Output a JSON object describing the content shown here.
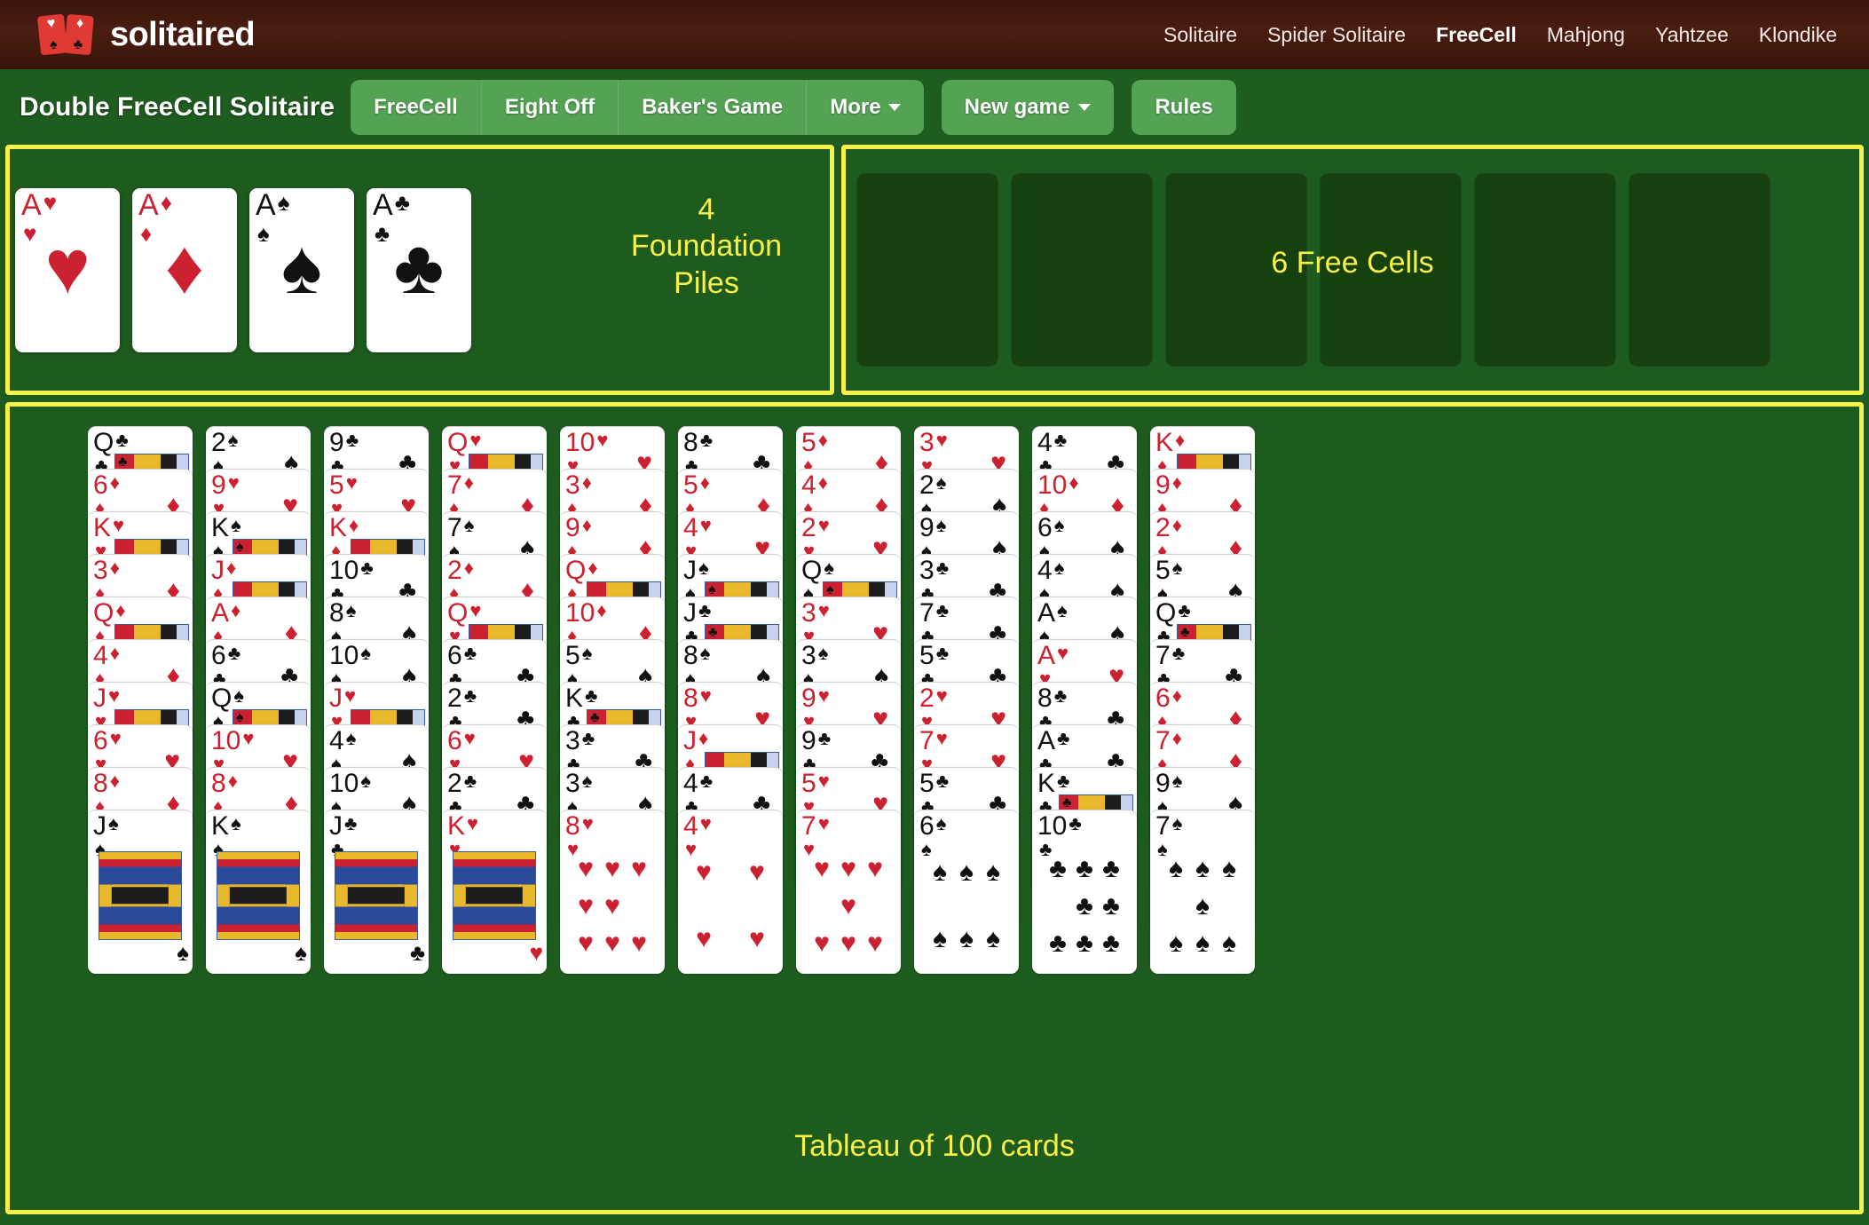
{
  "header": {
    "brand": "solitaired",
    "brand_icon": "two-playing-cards-logo",
    "nav": [
      {
        "label": "Solitaire",
        "active": false
      },
      {
        "label": "Spider Solitaire",
        "active": false
      },
      {
        "label": "FreeCell",
        "active": true
      },
      {
        "label": "Mahjong",
        "active": false
      },
      {
        "label": "Yahtzee",
        "active": false
      },
      {
        "label": "Klondike",
        "active": false
      }
    ]
  },
  "toolbar": {
    "game_title": "Double FreeCell Solitaire",
    "variants": [
      {
        "label": "FreeCell",
        "dropdown": false
      },
      {
        "label": "Eight Off",
        "dropdown": false
      },
      {
        "label": "Baker's Game",
        "dropdown": false
      },
      {
        "label": "More",
        "dropdown": true
      }
    ],
    "new_game_label": "New game",
    "rules_label": "Rules"
  },
  "board": {
    "foundation_label": "4\nFoundation\nPiles",
    "foundation_label_lines": [
      "4",
      "Foundation",
      "Piles"
    ],
    "freecell_label": "6 Free Cells",
    "tableau_label": "Tableau of 100 cards",
    "foundations": [
      {
        "rank": "A",
        "suit": "♥",
        "color": "red"
      },
      {
        "rank": "A",
        "suit": "♦",
        "color": "red"
      },
      {
        "rank": "A",
        "suit": "♠",
        "color": "black"
      },
      {
        "rank": "A",
        "suit": "♣",
        "color": "black"
      }
    ],
    "free_cells": [
      {
        "empty": true
      },
      {
        "empty": true
      },
      {
        "empty": true
      },
      {
        "empty": true
      },
      {
        "empty": true
      },
      {
        "empty": true
      }
    ],
    "colors": {
      "accent_yellow": "#f7f14a",
      "felt_green": "#1e5b1e",
      "button_green": "#54a354",
      "nav_brown": "#3b150c",
      "card_red": "#cc2131",
      "card_black": "#111111"
    },
    "tableau": [
      {
        "cards": [
          {
            "rank": "Q",
            "suit": "♣",
            "color": "black",
            "face": true
          },
          {
            "rank": "6",
            "suit": "♦",
            "color": "red",
            "face": false
          },
          {
            "rank": "K",
            "suit": "♥",
            "color": "red",
            "face": true
          },
          {
            "rank": "3",
            "suit": "♦",
            "color": "red",
            "face": false
          },
          {
            "rank": "Q",
            "suit": "♦",
            "color": "red",
            "face": true
          },
          {
            "rank": "4",
            "suit": "♦",
            "color": "red",
            "face": false
          },
          {
            "rank": "J",
            "suit": "♥",
            "color": "red",
            "face": true
          },
          {
            "rank": "6",
            "suit": "♥",
            "color": "red",
            "face": false
          },
          {
            "rank": "8",
            "suit": "♦",
            "color": "red",
            "face": false
          },
          {
            "rank": "J",
            "suit": "♠",
            "color": "black",
            "face": true,
            "bottom": true
          }
        ]
      },
      {
        "cards": [
          {
            "rank": "2",
            "suit": "♠",
            "color": "black",
            "face": false
          },
          {
            "rank": "9",
            "suit": "♥",
            "color": "red",
            "face": false
          },
          {
            "rank": "K",
            "suit": "♠",
            "color": "black",
            "face": true
          },
          {
            "rank": "J",
            "suit": "♦",
            "color": "red",
            "face": true
          },
          {
            "rank": "A",
            "suit": "♦",
            "color": "red",
            "face": false
          },
          {
            "rank": "6",
            "suit": "♣",
            "color": "black",
            "face": false
          },
          {
            "rank": "Q",
            "suit": "♠",
            "color": "black",
            "face": true
          },
          {
            "rank": "10",
            "suit": "♥",
            "color": "red",
            "face": false
          },
          {
            "rank": "8",
            "suit": "♦",
            "color": "red",
            "face": false
          },
          {
            "rank": "K",
            "suit": "♠",
            "color": "black",
            "face": true,
            "bottom": true
          }
        ]
      },
      {
        "cards": [
          {
            "rank": "9",
            "suit": "♣",
            "color": "black",
            "face": false
          },
          {
            "rank": "5",
            "suit": "♥",
            "color": "red",
            "face": false
          },
          {
            "rank": "K",
            "suit": "♦",
            "color": "red",
            "face": true
          },
          {
            "rank": "10",
            "suit": "♣",
            "color": "black",
            "face": false
          },
          {
            "rank": "8",
            "suit": "♠",
            "color": "black",
            "face": false
          },
          {
            "rank": "10",
            "suit": "♠",
            "color": "black",
            "face": false
          },
          {
            "rank": "J",
            "suit": "♥",
            "color": "red",
            "face": true
          },
          {
            "rank": "4",
            "suit": "♠",
            "color": "black",
            "face": false
          },
          {
            "rank": "10",
            "suit": "♠",
            "color": "black",
            "face": false
          },
          {
            "rank": "J",
            "suit": "♣",
            "color": "black",
            "face": true,
            "bottom": true
          }
        ]
      },
      {
        "cards": [
          {
            "rank": "Q",
            "suit": "♥",
            "color": "red",
            "face": true
          },
          {
            "rank": "7",
            "suit": "♦",
            "color": "red",
            "face": false
          },
          {
            "rank": "7",
            "suit": "♠",
            "color": "black",
            "face": false
          },
          {
            "rank": "2",
            "suit": "♦",
            "color": "red",
            "face": false
          },
          {
            "rank": "Q",
            "suit": "♥",
            "color": "red",
            "face": true
          },
          {
            "rank": "6",
            "suit": "♣",
            "color": "black",
            "face": false
          },
          {
            "rank": "2",
            "suit": "♣",
            "color": "black",
            "face": false
          },
          {
            "rank": "6",
            "suit": "♥",
            "color": "red",
            "face": false
          },
          {
            "rank": "2",
            "suit": "♣",
            "color": "black",
            "face": false
          },
          {
            "rank": "K",
            "suit": "♥",
            "color": "red",
            "face": true,
            "bottom": true
          }
        ]
      },
      {
        "cards": [
          {
            "rank": "10",
            "suit": "♥",
            "color": "red",
            "face": false
          },
          {
            "rank": "3",
            "suit": "♦",
            "color": "red",
            "face": false
          },
          {
            "rank": "9",
            "suit": "♦",
            "color": "red",
            "face": false
          },
          {
            "rank": "Q",
            "suit": "♦",
            "color": "red",
            "face": true
          },
          {
            "rank": "10",
            "suit": "♦",
            "color": "red",
            "face": false
          },
          {
            "rank": "5",
            "suit": "♠",
            "color": "black",
            "face": false
          },
          {
            "rank": "K",
            "suit": "♣",
            "color": "black",
            "face": true
          },
          {
            "rank": "3",
            "suit": "♣",
            "color": "black",
            "face": false
          },
          {
            "rank": "3",
            "suit": "♠",
            "color": "black",
            "face": false
          },
          {
            "rank": "8",
            "suit": "♥",
            "color": "red",
            "face": false,
            "bottom": true,
            "pips": 8
          }
        ]
      },
      {
        "cards": [
          {
            "rank": "8",
            "suit": "♣",
            "color": "black",
            "face": false
          },
          {
            "rank": "5",
            "suit": "♦",
            "color": "red",
            "face": false
          },
          {
            "rank": "4",
            "suit": "♥",
            "color": "red",
            "face": false
          },
          {
            "rank": "J",
            "suit": "♠",
            "color": "black",
            "face": true
          },
          {
            "rank": "J",
            "suit": "♣",
            "color": "black",
            "face": true
          },
          {
            "rank": "8",
            "suit": "♠",
            "color": "black",
            "face": false
          },
          {
            "rank": "8",
            "suit": "♥",
            "color": "red",
            "face": false
          },
          {
            "rank": "J",
            "suit": "♦",
            "color": "red",
            "face": true
          },
          {
            "rank": "4",
            "suit": "♣",
            "color": "black",
            "face": false
          },
          {
            "rank": "4",
            "suit": "♥",
            "color": "red",
            "face": false,
            "bottom": true,
            "pips": 4
          }
        ]
      },
      {
        "cards": [
          {
            "rank": "5",
            "suit": "♦",
            "color": "red",
            "face": false
          },
          {
            "rank": "4",
            "suit": "♦",
            "color": "red",
            "face": false
          },
          {
            "rank": "2",
            "suit": "♥",
            "color": "red",
            "face": false
          },
          {
            "rank": "Q",
            "suit": "♠",
            "color": "black",
            "face": true
          },
          {
            "rank": "3",
            "suit": "♥",
            "color": "red",
            "face": false
          },
          {
            "rank": "3",
            "suit": "♠",
            "color": "black",
            "face": false
          },
          {
            "rank": "9",
            "suit": "♥",
            "color": "red",
            "face": false
          },
          {
            "rank": "9",
            "suit": "♣",
            "color": "black",
            "face": false
          },
          {
            "rank": "5",
            "suit": "♥",
            "color": "red",
            "face": false
          },
          {
            "rank": "7",
            "suit": "♥",
            "color": "red",
            "face": false,
            "bottom": true,
            "pips": 7
          }
        ]
      },
      {
        "cards": [
          {
            "rank": "3",
            "suit": "♥",
            "color": "red",
            "face": false
          },
          {
            "rank": "2",
            "suit": "♠",
            "color": "black",
            "face": false
          },
          {
            "rank": "9",
            "suit": "♠",
            "color": "black",
            "face": false
          },
          {
            "rank": "3",
            "suit": "♣",
            "color": "black",
            "face": false
          },
          {
            "rank": "7",
            "suit": "♣",
            "color": "black",
            "face": false
          },
          {
            "rank": "5",
            "suit": "♣",
            "color": "black",
            "face": false
          },
          {
            "rank": "2",
            "suit": "♥",
            "color": "red",
            "face": false
          },
          {
            "rank": "7",
            "suit": "♥",
            "color": "red",
            "face": false
          },
          {
            "rank": "5",
            "suit": "♣",
            "color": "black",
            "face": false
          },
          {
            "rank": "6",
            "suit": "♠",
            "color": "black",
            "face": false,
            "bottom": true,
            "pips": 6
          }
        ]
      },
      {
        "cards": [
          {
            "rank": "4",
            "suit": "♣",
            "color": "black",
            "face": false
          },
          {
            "rank": "10",
            "suit": "♦",
            "color": "red",
            "face": false
          },
          {
            "rank": "6",
            "suit": "♠",
            "color": "black",
            "face": false
          },
          {
            "rank": "4",
            "suit": "♠",
            "color": "black",
            "face": false
          },
          {
            "rank": "A",
            "suit": "♠",
            "color": "black",
            "face": false
          },
          {
            "rank": "A",
            "suit": "♥",
            "color": "red",
            "face": false
          },
          {
            "rank": "8",
            "suit": "♣",
            "color": "black",
            "face": false
          },
          {
            "rank": "A",
            "suit": "♣",
            "color": "black",
            "face": false
          },
          {
            "rank": "K",
            "suit": "♣",
            "color": "black",
            "face": true
          },
          {
            "rank": "10",
            "suit": "♣",
            "color": "black",
            "face": false,
            "bottom": true,
            "pips": 10
          }
        ]
      },
      {
        "cards": [
          {
            "rank": "K",
            "suit": "♦",
            "color": "red",
            "face": true
          },
          {
            "rank": "9",
            "suit": "♦",
            "color": "red",
            "face": false
          },
          {
            "rank": "2",
            "suit": "♦",
            "color": "red",
            "face": false
          },
          {
            "rank": "5",
            "suit": "♠",
            "color": "black",
            "face": false
          },
          {
            "rank": "Q",
            "suit": "♣",
            "color": "black",
            "face": true
          },
          {
            "rank": "7",
            "suit": "♣",
            "color": "black",
            "face": false
          },
          {
            "rank": "6",
            "suit": "♦",
            "color": "red",
            "face": false
          },
          {
            "rank": "7",
            "suit": "♦",
            "color": "red",
            "face": false
          },
          {
            "rank": "9",
            "suit": "♠",
            "color": "black",
            "face": false
          },
          {
            "rank": "7",
            "suit": "♠",
            "color": "black",
            "face": false,
            "bottom": true,
            "pips": 7
          }
        ]
      }
    ]
  }
}
